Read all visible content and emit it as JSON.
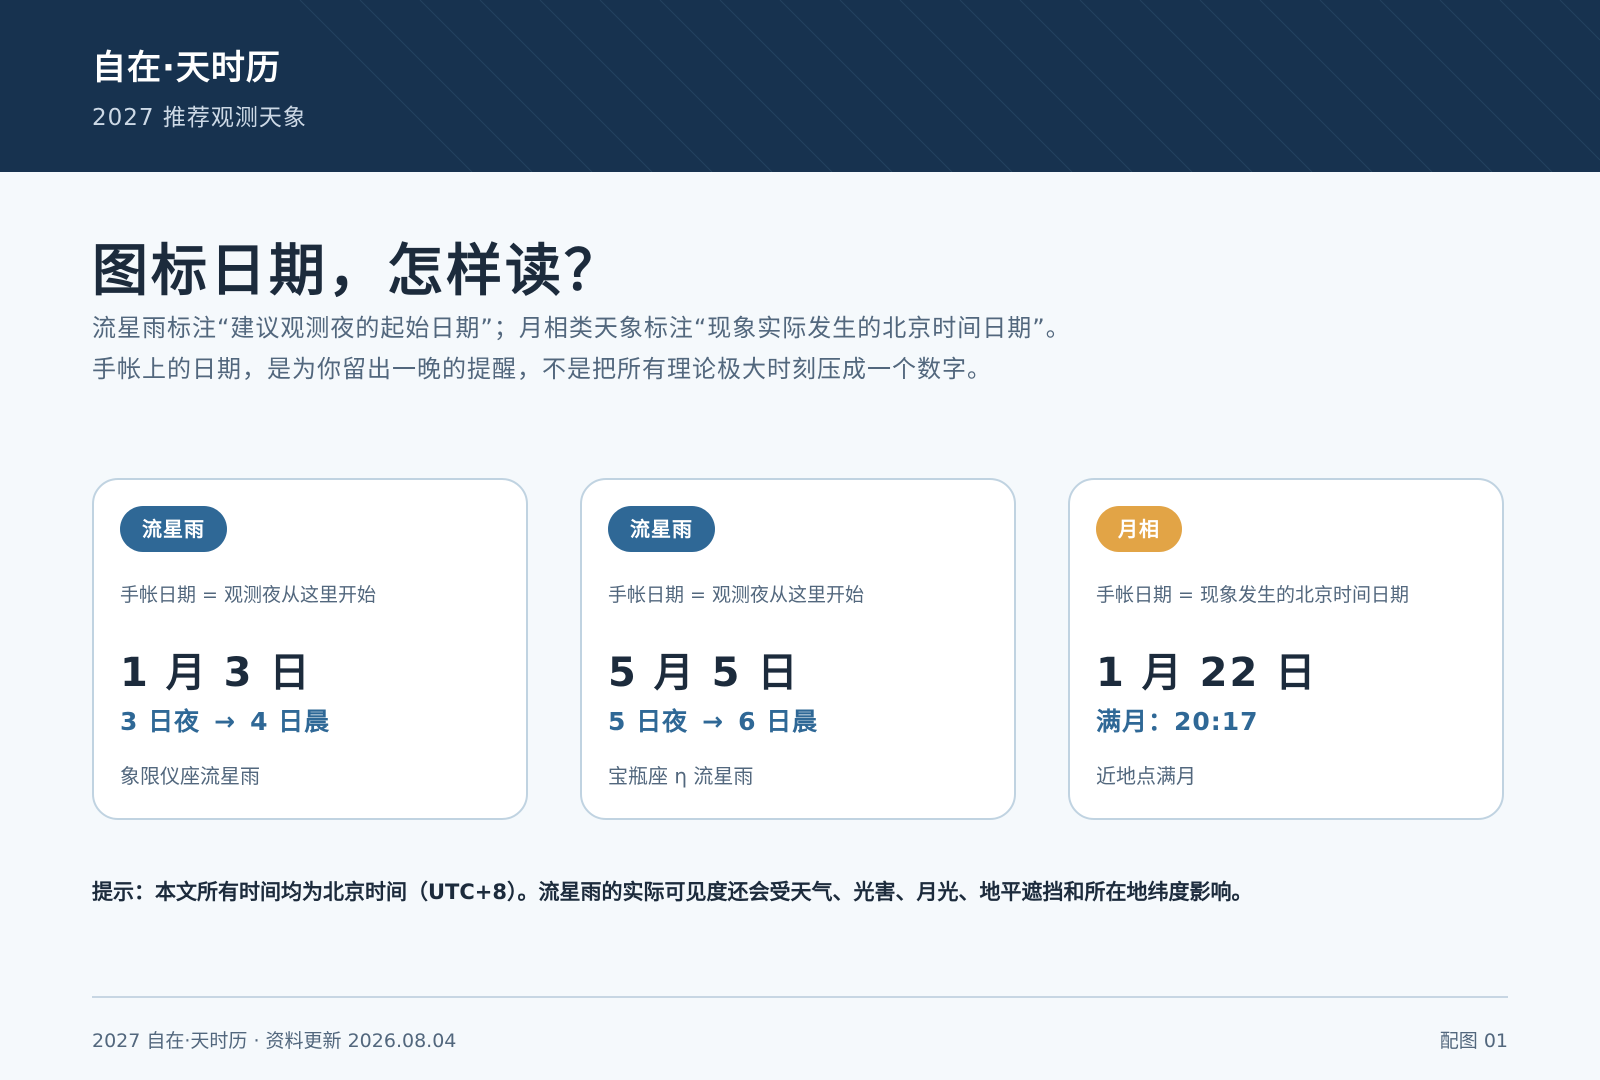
{
  "header": {
    "brand": "自在·天时历",
    "subtitle": "2027  推荐观测天象"
  },
  "main": {
    "title": "图标日期，怎样读？",
    "intro_line1": "流星雨标注“建议观测夜的起始日期”；月相类天象标注“现象实际发生的北京时间日期”。",
    "intro_line2": "手帐上的日期，是为你留出一晚的提醒，不是把所有理论极大时刻压成一个数字。"
  },
  "cards": [
    {
      "tag": "流星雨",
      "tag_color": "#2f6896",
      "rule": "手帐日期 = 观测夜从这里开始",
      "date": "1 月 3 日",
      "detail_from": "3 日夜",
      "arrow": "→",
      "detail_to": "4 日晨",
      "name": "象限仪座流星雨"
    },
    {
      "tag": "流星雨",
      "tag_color": "#2f6896",
      "rule": "手帐日期 = 观测夜从这里开始",
      "date": "5 月 5 日",
      "detail_from": "5 日夜",
      "arrow": "→",
      "detail_to": "6 日晨",
      "name": "宝瓶座 η 流星雨"
    },
    {
      "tag": "月相",
      "tag_color": "#e2a446",
      "rule": "手帐日期 = 现象发生的北京时间日期",
      "date": "1 月 22 日",
      "detail": "满月：20:17",
      "name": "近地点满月"
    }
  ],
  "note": "提示：本文所有时间均为北京时间（UTC+8）。流星雨的实际可见度还会受天气、光害、月光、地平遮挡和所在地纬度影响。",
  "footer": {
    "left": "2027 自在·天时历  ·  资料更新 2026.08.04",
    "right": "配图 01"
  }
}
